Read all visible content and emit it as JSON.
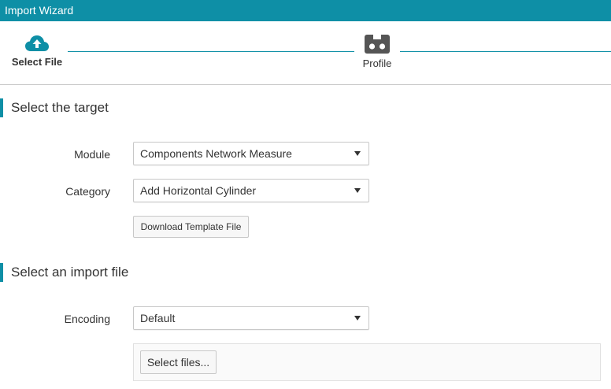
{
  "window": {
    "title": "Import Wizard"
  },
  "stepper": {
    "steps": [
      {
        "label": "Select File",
        "icon": "cloud-upload-icon",
        "active": true
      },
      {
        "label": "Profile",
        "icon": "profile-icon",
        "active": false
      }
    ]
  },
  "target_section": {
    "heading": "Select the target",
    "module": {
      "label": "Module",
      "value": "Components Network Measure"
    },
    "category": {
      "label": "Category",
      "value": "Add Horizontal Cylinder"
    },
    "download_button": "Download Template File"
  },
  "import_section": {
    "heading": "Select an import file",
    "encoding": {
      "label": "Encoding",
      "value": "Default"
    },
    "select_files_button": "Select files..."
  },
  "colors": {
    "accent": "#0e8fa6",
    "icon": "#555555"
  }
}
